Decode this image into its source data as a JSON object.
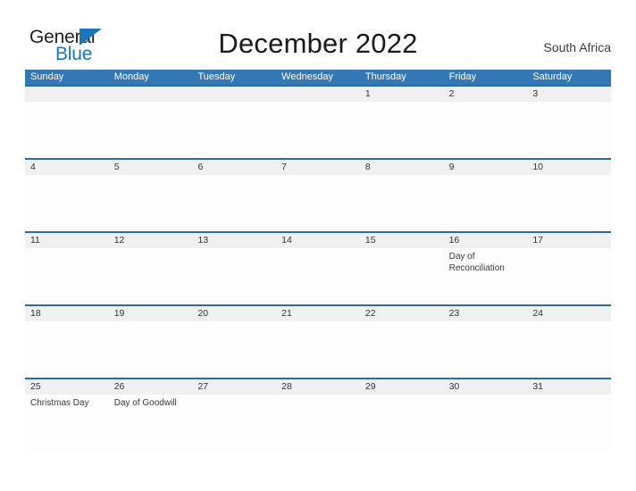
{
  "brand": {
    "name_part1": "General",
    "name_part2": "Blue",
    "triangle_color": "#1b75bb",
    "text_color": "#231f20"
  },
  "header": {
    "title": "December 2022",
    "country": "South Africa",
    "header_bg_color": "#3377b5",
    "row_border_color": "#2b6ca3",
    "date_band_color": "#f0f0f0"
  },
  "weekdays": [
    "Sunday",
    "Monday",
    "Tuesday",
    "Wednesday",
    "Thursday",
    "Friday",
    "Saturday"
  ],
  "weeks": [
    {
      "dates": [
        "",
        "",
        "",
        "",
        "1",
        "2",
        "3"
      ],
      "events": [
        "",
        "",
        "",
        "",
        "",
        "",
        ""
      ]
    },
    {
      "dates": [
        "4",
        "5",
        "6",
        "7",
        "8",
        "9",
        "10"
      ],
      "events": [
        "",
        "",
        "",
        "",
        "",
        "",
        ""
      ]
    },
    {
      "dates": [
        "11",
        "12",
        "13",
        "14",
        "15",
        "16",
        "17"
      ],
      "events": [
        "",
        "",
        "",
        "",
        "",
        "Day of Reconciliation",
        ""
      ]
    },
    {
      "dates": [
        "18",
        "19",
        "20",
        "21",
        "22",
        "23",
        "24"
      ],
      "events": [
        "",
        "",
        "",
        "",
        "",
        "",
        ""
      ]
    },
    {
      "dates": [
        "25",
        "26",
        "27",
        "28",
        "29",
        "30",
        "31"
      ],
      "events": [
        "Christmas Day",
        "Day of Goodwill",
        "",
        "",
        "",
        "",
        ""
      ]
    }
  ]
}
